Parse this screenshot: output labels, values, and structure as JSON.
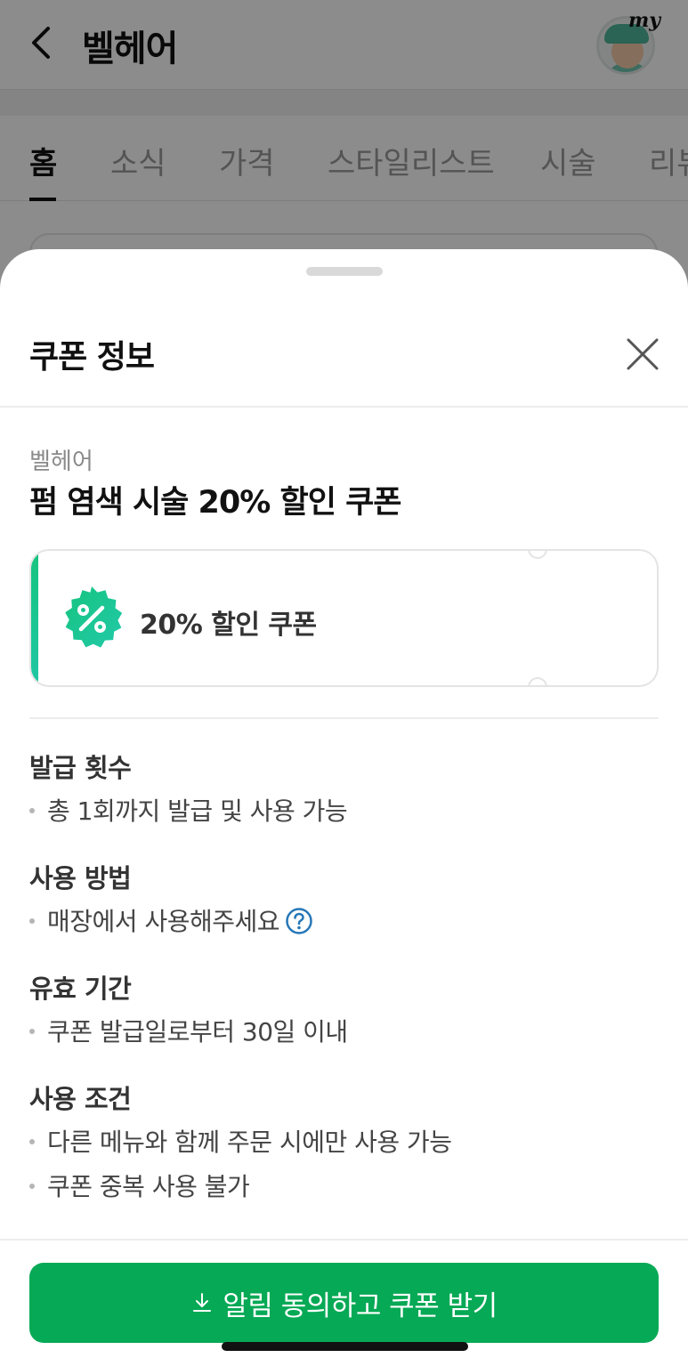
{
  "background_page": {
    "title": "벨헤어",
    "avatar_badge": "my",
    "tabs": [
      {
        "label": "홈",
        "active": true
      },
      {
        "label": "소식",
        "active": false
      },
      {
        "label": "가격",
        "active": false
      },
      {
        "label": "스타일리스트",
        "active": false
      },
      {
        "label": "시술",
        "active": false
      },
      {
        "label": "리뷰",
        "active": false
      }
    ]
  },
  "sheet": {
    "title": "쿠폰 정보",
    "shop_name": "벨헤어",
    "coupon_title": "펌 염색 시술 20% 할인 쿠폰",
    "coupon_card": {
      "label": "20% 할인 쿠폰",
      "badge_icon": "percent-badge-icon",
      "accent_color": "#16c47f"
    },
    "sections": {
      "issue_count": {
        "heading": "발급 횟수",
        "items": [
          "총 1회까지 발급 및 사용 가능"
        ]
      },
      "usage_method": {
        "heading": "사용 방법",
        "items": [
          "매장에서 사용해주세요"
        ]
      },
      "validity": {
        "heading": "유효 기간",
        "items": [
          "쿠폰 발급일로부터 30일 이내"
        ]
      },
      "conditions": {
        "heading": "사용 조건",
        "items": [
          "다른 메뉴와 함께 주문 시에만 사용 가능",
          "쿠폰 중복 사용 불가"
        ]
      }
    },
    "cta": {
      "label": "알림 동의하고 쿠폰 받기",
      "icon": "download-icon",
      "color": "#06a955"
    }
  }
}
